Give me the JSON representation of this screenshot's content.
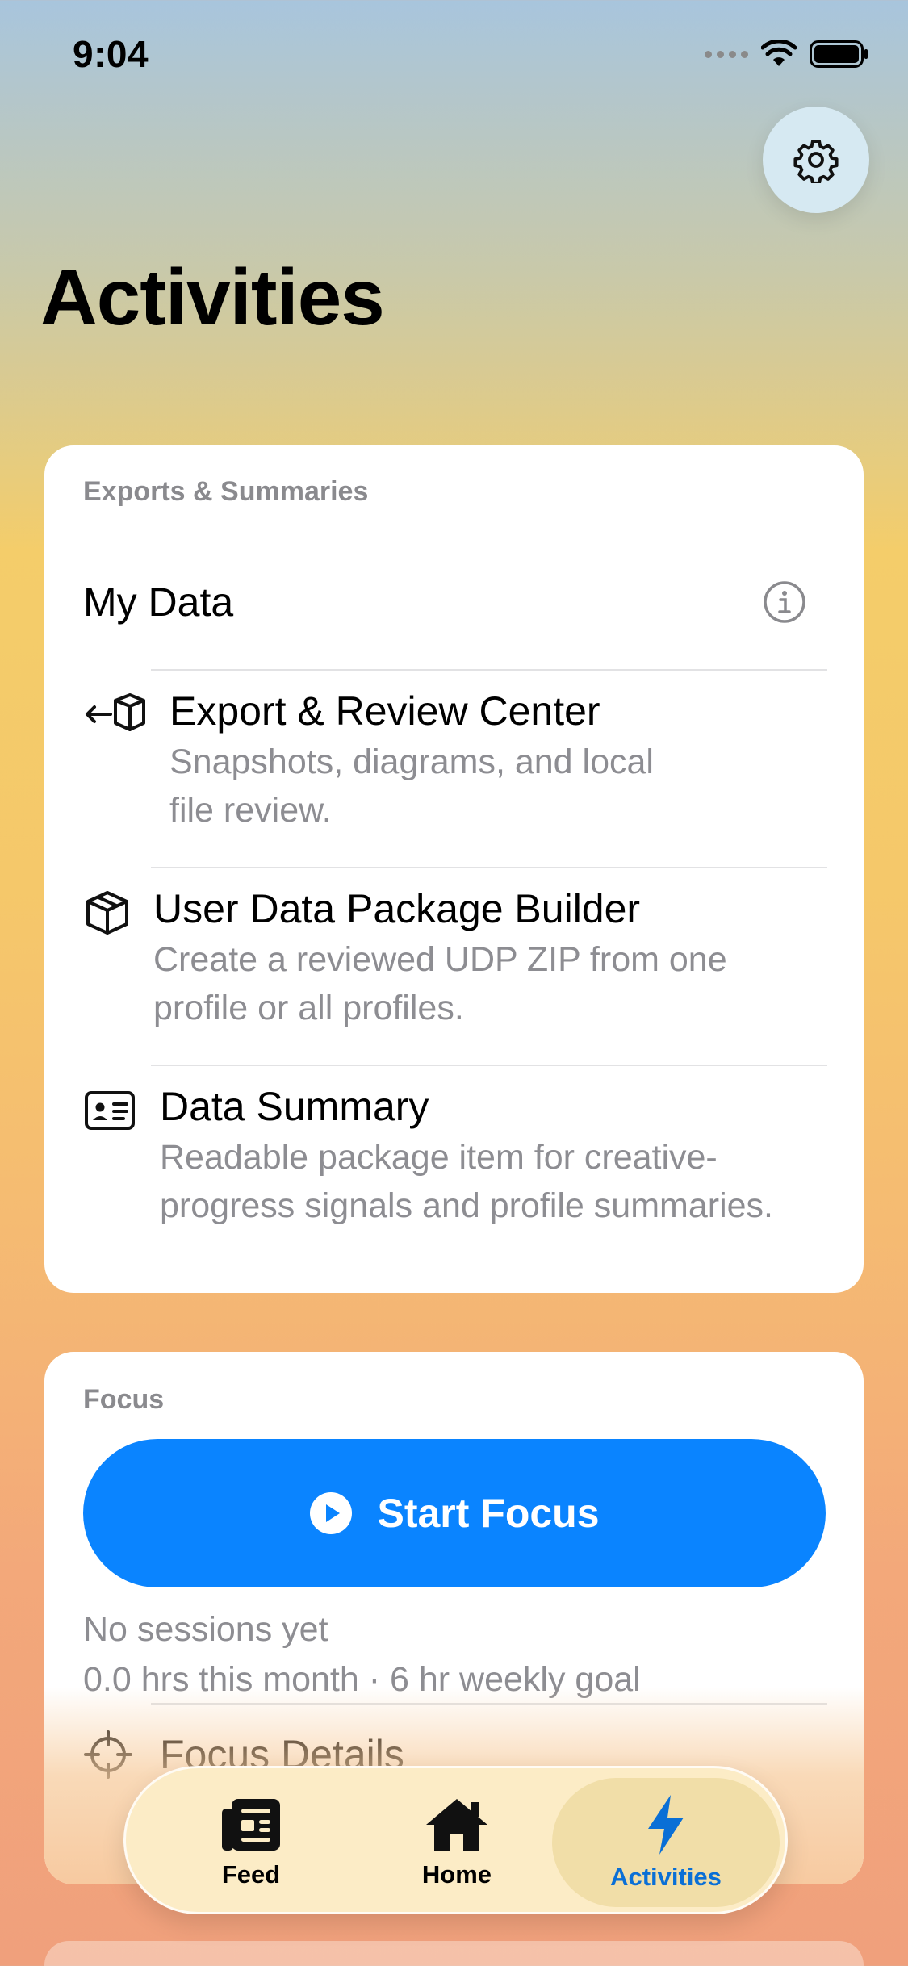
{
  "status_bar": {
    "time": "9:04"
  },
  "page": {
    "title": "Activities"
  },
  "exports_card": {
    "section_label": "Exports & Summaries",
    "my_data_title": "My Data",
    "rows": [
      {
        "title": "Export & Review Center",
        "subtitle_line1": "Snapshots, diagrams, and local",
        "subtitle_line2": "file review.",
        "icon": "box-export-icon"
      },
      {
        "title": "User Data Package Builder",
        "subtitle_line1": "Create a reviewed UDP ZIP from one",
        "subtitle_line2": "profile or all profiles.",
        "icon": "package-icon"
      },
      {
        "title": "Data Summary",
        "subtitle_line1": "Readable package item for creative-",
        "subtitle_line2": "progress signals and profile summaries.",
        "icon": "id-card-icon"
      }
    ]
  },
  "focus_card": {
    "section_label": "Focus",
    "start_button_label": "Start Focus",
    "sessions_text": "No sessions yet",
    "hours_text": "0.0 hrs this month · 6 hr weekly goal",
    "details_title": "Focus Details"
  },
  "tab_bar": {
    "tabs": [
      {
        "label": "Feed",
        "icon": "newspaper-icon"
      },
      {
        "label": "Home",
        "icon": "house-icon"
      },
      {
        "label": "Activities",
        "icon": "bolt-icon",
        "selected": true
      }
    ]
  },
  "colors": {
    "accent": "#0a84ff",
    "selected_tab_text": "#0a6fd6"
  }
}
